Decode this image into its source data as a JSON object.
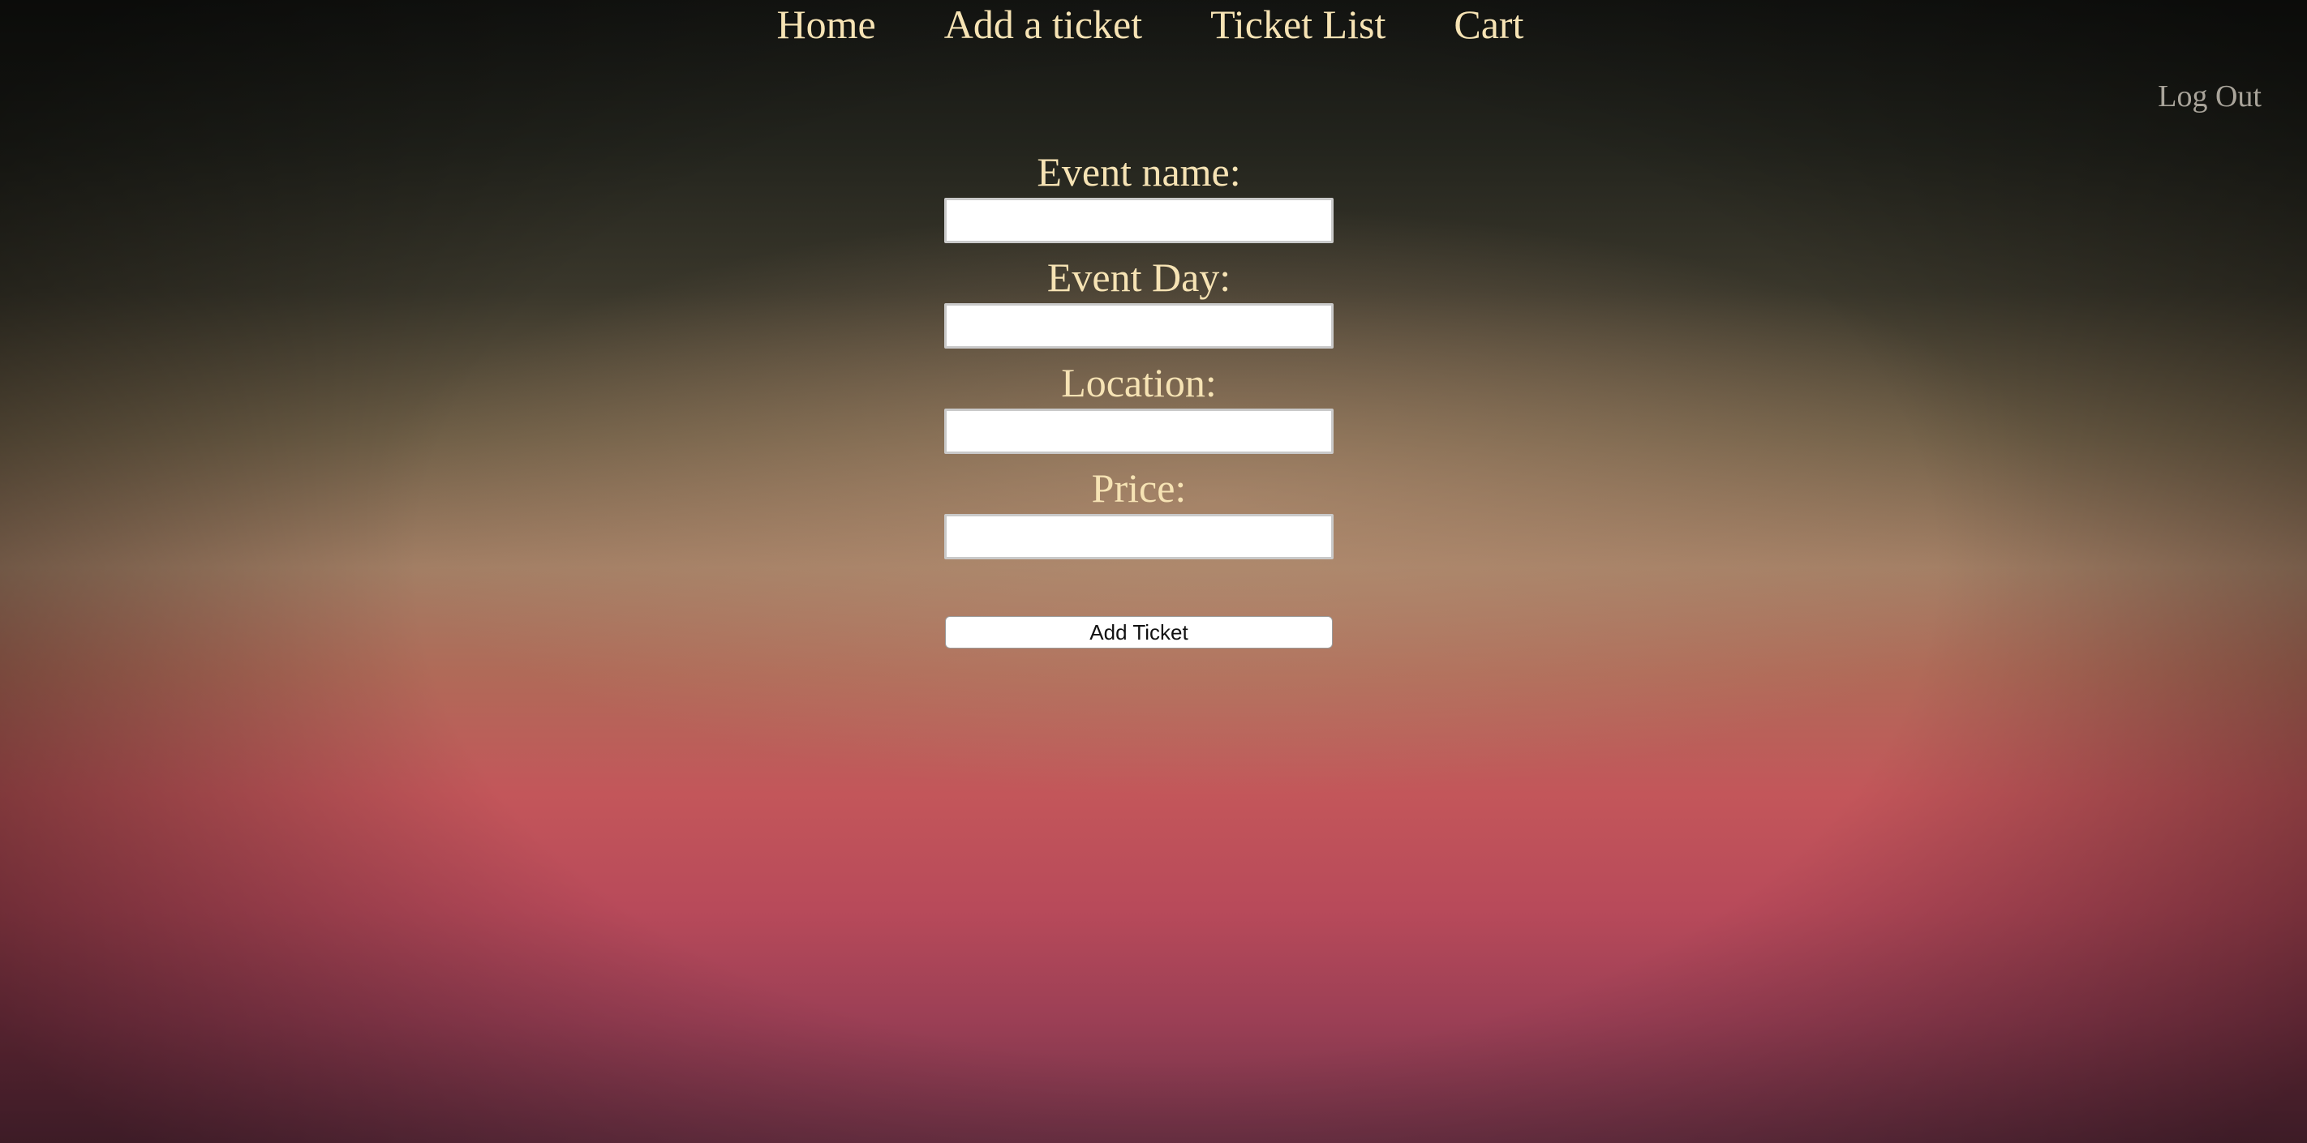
{
  "nav": {
    "items": [
      {
        "label": "Home"
      },
      {
        "label": "Add a ticket"
      },
      {
        "label": "Ticket List"
      },
      {
        "label": "Cart"
      }
    ],
    "logout_label": "Log Out"
  },
  "form": {
    "fields": [
      {
        "label": "Event name:",
        "value": "",
        "placeholder": ""
      },
      {
        "label": "Event Day:",
        "value": "",
        "placeholder": ""
      },
      {
        "label": "Location:",
        "value": "",
        "placeholder": ""
      },
      {
        "label": "Price:",
        "value": "",
        "placeholder": ""
      }
    ],
    "submit_label": "Add Ticket"
  },
  "colors": {
    "nav_text": "#f6e3b4",
    "logout_text": "#a9a49a",
    "label_text": "#f6e3b4"
  }
}
